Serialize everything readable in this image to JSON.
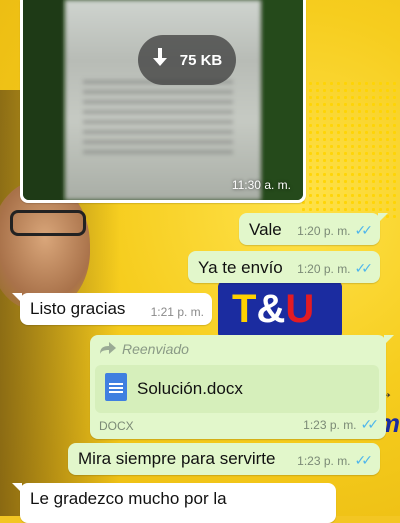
{
  "image_message": {
    "download_size": "75 KB",
    "time": "11:30 a. m."
  },
  "messages": [
    {
      "text": "Vale",
      "time": "1:20 p. m."
    },
    {
      "text": "Ya te envío",
      "time": "1:20 p. m."
    },
    {
      "text": "Listo gracias",
      "time": "1:21 p. m."
    },
    {
      "text": "Mira siempre para servirte",
      "time": "1:23 p. m."
    },
    {
      "text": "Le gradezco mucho por la"
    }
  ],
  "document_message": {
    "forwarded_label": "Reenviado",
    "file_name": "Solución.docx",
    "file_type": "DOCX",
    "time": "1:23 p. m."
  },
  "wallpaper": {
    "logo_text_t": "T",
    "logo_text_amp": "&",
    "logo_text_u": "U"
  },
  "colors": {
    "outgoing_bubble": "#e2f7cb",
    "incoming_bubble": "#ffffff",
    "read_ticks": "#4fb6ec",
    "wallpaper": "#f3c623"
  },
  "icons": [
    "download-icon",
    "double-check-icon",
    "forward-icon",
    "document-icon"
  ]
}
